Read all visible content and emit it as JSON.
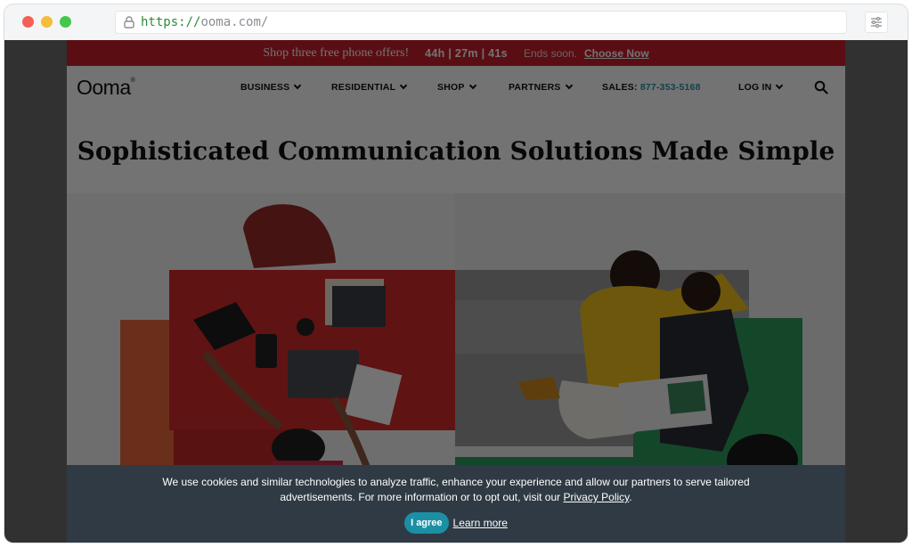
{
  "browser": {
    "url_scheme": "https://",
    "url_host": "ooma.com/"
  },
  "promo": {
    "offer": "Shop three free phone offers!",
    "timer": "44h | 27m | 41s",
    "ends": "Ends soon.",
    "cta": "Choose Now"
  },
  "nav": {
    "logo": "Ooma",
    "items": [
      {
        "label": "BUSINESS"
      },
      {
        "label": "RESIDENTIAL"
      },
      {
        "label": "SHOP"
      },
      {
        "label": "PARTNERS"
      }
    ],
    "sales_label": "SALES:",
    "sales_phone": "877-353-5168",
    "login": "LOG IN"
  },
  "hero": {
    "title": "Sophisticated Communication Solutions Made Simple"
  },
  "cookie": {
    "text_before": "We use cookies and similar technologies to analyze traffic, enhance your experience and allow our partners to serve tailored advertisements. For more information or to opt out, visit our ",
    "policy_link": "Privacy Policy",
    "text_after": ".",
    "agree_button": "I agree",
    "learn_more": "Learn more"
  },
  "colors": {
    "promo_red": "#c8202a",
    "accent_teal": "#2a93a8",
    "cookie_bg": "#2f3a44"
  }
}
